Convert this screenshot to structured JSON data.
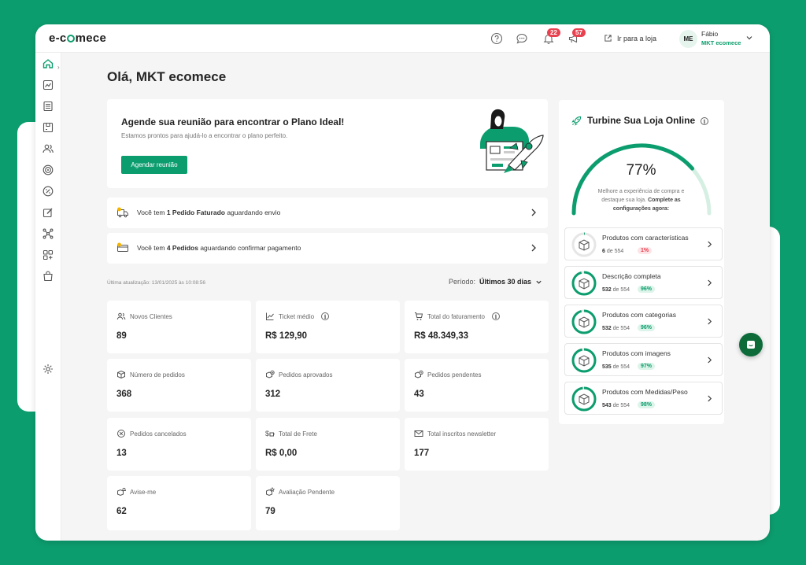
{
  "logo": {
    "text_before": "e-c",
    "text_after": "mece"
  },
  "topbar": {
    "help_icon": "help-circle-icon",
    "chat_icon": "chat-bubble-icon",
    "notifications": {
      "icon": "bell-icon",
      "count": "22"
    },
    "messages": {
      "icon": "megaphone-icon",
      "count": "57"
    },
    "goto_store_label": "Ir para a loja",
    "user": {
      "initials": "ME",
      "name": "Fábio",
      "store": "MKT ecomece"
    }
  },
  "sidebar": {
    "items": [
      "home-icon",
      "chart-icon",
      "catalog-icon",
      "orders-icon",
      "customers-icon",
      "target-icon",
      "discount-icon",
      "edit-icon",
      "integrations-icon",
      "apps-icon",
      "shopping-bag-icon"
    ],
    "settings": "gear-icon"
  },
  "greeting": "Olá, MKT ecomece",
  "promo": {
    "title": "Agende sua reunião para encontrar o Plano Ideal!",
    "subtitle": "Estamos prontos para ajudá-lo a encontrar o plano perfeito.",
    "button": "Agendar reunião"
  },
  "notices": [
    {
      "prefix": "Você tem ",
      "bold": "1 Pedido Faturado",
      "suffix": " aguardando envio"
    },
    {
      "prefix": "Você tem ",
      "bold": "4 Pedidos",
      "suffix": " aguardando confirmar pagamento"
    }
  ],
  "last_update": "Última atualização: 13/01/2025 às 10:08:56",
  "period": {
    "label": "Período:",
    "value": "Últimos 30 dias"
  },
  "metrics": [
    {
      "label": "Novos Clientes",
      "value": "89",
      "icon": "users-icon",
      "info": false
    },
    {
      "label": "Ticket médio",
      "value": "R$ 129,90",
      "icon": "trend-up-icon",
      "info": true
    },
    {
      "label": "Total do faturamento",
      "value": "R$ 48.349,33",
      "icon": "cart-money-icon",
      "info": true
    },
    {
      "label": "Número de pedidos",
      "value": "368",
      "icon": "box-icon",
      "info": false
    },
    {
      "label": "Pedidos aprovados",
      "value": "312",
      "icon": "box-check-icon",
      "info": false
    },
    {
      "label": "Pedidos pendentes",
      "value": "43",
      "icon": "box-clock-icon",
      "info": false
    },
    {
      "label": "Pedidos cancelados",
      "value": "13",
      "icon": "cancel-circle-icon",
      "info": false
    },
    {
      "label": "Total de Frete",
      "value": "R$ 0,00",
      "icon": "shipping-money-icon",
      "info": false
    },
    {
      "label": "Total inscritos newsletter",
      "value": "177",
      "icon": "mail-icon",
      "info": false
    },
    {
      "label": "Avise-me",
      "value": "62",
      "icon": "box-bell-icon",
      "info": false
    },
    {
      "label": "Avaliação Pendente",
      "value": "79",
      "icon": "box-star-icon",
      "info": false
    }
  ],
  "turbine": {
    "title": "Turbine Sua Loja Online",
    "progress_text": "77%",
    "progress": 0.77,
    "desc_prefix": "Melhore a experiência de compra e destaque sua loja. ",
    "desc_bold": "Complete as configurações agora:",
    "tasks": [
      {
        "title": "Produtos com características",
        "done": "6",
        "of": " de 554",
        "pct": "1%",
        "fraction": 0.01
      },
      {
        "title": "Descrição completa",
        "done": "532",
        "of": " de 554",
        "pct": "96%",
        "fraction": 0.96
      },
      {
        "title": "Produtos com categorias",
        "done": "532",
        "of": " de 554",
        "pct": "96%",
        "fraction": 0.96
      },
      {
        "title": "Produtos com imagens",
        "done": "535",
        "of": " de 554",
        "pct": "97%",
        "fraction": 0.97
      },
      {
        "title": "Produtos com Medidas/Peso",
        "done": "543",
        "of": " de 554",
        "pct": "98%",
        "fraction": 0.98
      }
    ]
  },
  "colors": {
    "brand": "#0c9d6e",
    "alert": "#e8414f",
    "fab": "#0d6b3a"
  }
}
